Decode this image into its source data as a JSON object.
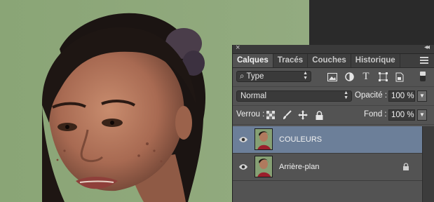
{
  "canvas": {
    "description_icon": "portrait-photo"
  },
  "panel": {
    "close_glyph": "×",
    "collapse_glyph": "◂◂",
    "tabs": [
      {
        "label": "Calques",
        "active": true
      },
      {
        "label": "Tracés",
        "active": false
      },
      {
        "label": "Couches",
        "active": false
      },
      {
        "label": "Historique",
        "active": false
      }
    ],
    "filter": {
      "kind_label": "Type",
      "icons": [
        "image-filter-icon",
        "adjustment-filter-icon",
        "text-filter-icon",
        "shape-filter-icon",
        "smart-object-filter-icon"
      ]
    },
    "blend": {
      "mode": "Normal",
      "opacity_label": "Opacité :",
      "opacity_value": "100 %"
    },
    "lock": {
      "label": "Verrou :",
      "fill_label": "Fond :",
      "fill_value": "100 %"
    },
    "layers": [
      {
        "name": "COULEURS",
        "selected": true,
        "locked": false
      },
      {
        "name": "Arrière-plan",
        "selected": false,
        "locked": true
      }
    ]
  },
  "colors": {
    "panel_bg": "#535353",
    "selected_layer": "#6c7f99",
    "canvas_bg": "#8da77a"
  }
}
